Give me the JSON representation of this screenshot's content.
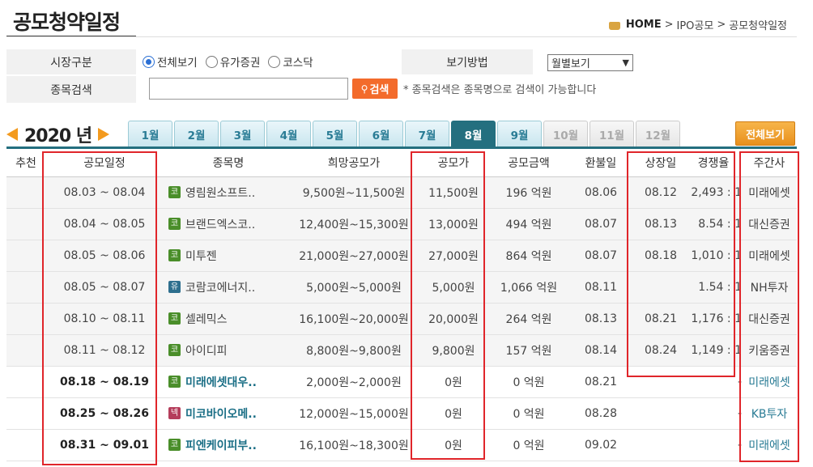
{
  "page": {
    "title": "공모청약일정",
    "breadcrumb": {
      "home": "HOME",
      "sep": ">",
      "level1": "IPO공모",
      "level2": "공모청약일정"
    }
  },
  "filters": {
    "market_label": "시장구분",
    "markets": [
      {
        "label": "전체보기",
        "checked": true
      },
      {
        "label": "유가증권",
        "checked": false
      },
      {
        "label": "코스닥",
        "checked": false
      }
    ],
    "search_label": "종목검색",
    "search_value": "",
    "search_button": "검색",
    "search_note": "* 종목검색은 종목명으로 검색이 가능합니다",
    "view_label": "보기방법",
    "view_selected": "월별보기"
  },
  "calendar": {
    "year": "2020",
    "year_suffix": "년",
    "months": [
      {
        "label": "1월",
        "state": "normal"
      },
      {
        "label": "2월",
        "state": "normal"
      },
      {
        "label": "3월",
        "state": "normal"
      },
      {
        "label": "4월",
        "state": "normal"
      },
      {
        "label": "5월",
        "state": "normal"
      },
      {
        "label": "6월",
        "state": "normal"
      },
      {
        "label": "7월",
        "state": "normal"
      },
      {
        "label": "8월",
        "state": "active"
      },
      {
        "label": "9월",
        "state": "normal"
      },
      {
        "label": "10월",
        "state": "disabled"
      },
      {
        "label": "11월",
        "state": "disabled"
      },
      {
        "label": "12월",
        "state": "disabled"
      }
    ],
    "view_all": "전체보기"
  },
  "table": {
    "headers": [
      "추천",
      "공모일정",
      "종목명",
      "희망공모가",
      "공모가",
      "공모금액",
      "환불일",
      "상장일",
      "경쟁율",
      "주간사"
    ],
    "rows": [
      {
        "recommend": "",
        "schedule": "08.03 ~ 08.04",
        "market": "코",
        "name": "영림원소프트..",
        "hope_price": "9,500원~11,500원",
        "offer_price": "11,500원",
        "amount": "196 억원",
        "refund": "08.06",
        "listing": "08.12",
        "ratio": "2,493 : 1",
        "underwriter": "미래에셋",
        "upcoming": false
      },
      {
        "recommend": "",
        "schedule": "08.04 ~ 08.05",
        "market": "코",
        "name": "브랜드엑스코..",
        "hope_price": "12,400원~15,300원",
        "offer_price": "13,000원",
        "amount": "494 억원",
        "refund": "08.07",
        "listing": "08.13",
        "ratio": "8.54 : 1",
        "underwriter": "대신증권",
        "upcoming": false
      },
      {
        "recommend": "",
        "schedule": "08.05 ~ 08.06",
        "market": "코",
        "name": "미투젠",
        "hope_price": "21,000원~27,000원",
        "offer_price": "27,000원",
        "amount": "864 억원",
        "refund": "08.07",
        "listing": "08.18",
        "ratio": "1,010 : 1",
        "underwriter": "미래에셋",
        "upcoming": false
      },
      {
        "recommend": "",
        "schedule": "08.05 ~ 08.07",
        "market": "유",
        "name": "코람코에너지..",
        "hope_price": "5,000원~5,000원",
        "offer_price": "5,000원",
        "amount": "1,066 억원",
        "refund": "08.11",
        "listing": "",
        "ratio": "1.54 : 1",
        "underwriter": "NH투자",
        "upcoming": false
      },
      {
        "recommend": "",
        "schedule": "08.10 ~ 08.11",
        "market": "코",
        "name": "셀레믹스",
        "hope_price": "16,100원~20,000원",
        "offer_price": "20,000원",
        "amount": "264 억원",
        "refund": "08.13",
        "listing": "08.21",
        "ratio": "1,176 : 1",
        "underwriter": "대신증권",
        "upcoming": false
      },
      {
        "recommend": "",
        "schedule": "08.11 ~ 08.12",
        "market": "코",
        "name": "아이디피",
        "hope_price": "8,800원~9,800원",
        "offer_price": "9,800원",
        "amount": "157 억원",
        "refund": "08.14",
        "listing": "08.24",
        "ratio": "1,149 : 1",
        "underwriter": "키움증권",
        "upcoming": false
      },
      {
        "recommend": "",
        "schedule": "08.18 ~ 08.19",
        "market": "코",
        "name": "미래에셋대우..",
        "hope_price": "2,000원~2,000원",
        "offer_price": "0원",
        "amount": "0 억원",
        "refund": "08.21",
        "listing": "",
        "ratio": "-",
        "underwriter": "미래에셋",
        "upcoming": true
      },
      {
        "recommend": "",
        "schedule": "08.25 ~ 08.26",
        "market": "넥",
        "name": "미코바이오메..",
        "hope_price": "12,000원~15,000원",
        "offer_price": "0원",
        "amount": "0 억원",
        "refund": "08.28",
        "listing": "",
        "ratio": "-",
        "underwriter": "KB투자",
        "upcoming": true
      },
      {
        "recommend": "",
        "schedule": "08.31 ~ 09.01",
        "market": "코",
        "name": "피엔케이피부..",
        "hope_price": "16,100원~18,300원",
        "offer_price": "0원",
        "amount": "0 억원",
        "refund": "09.02",
        "listing": "",
        "ratio": "-",
        "underwriter": "미래에셋",
        "upcoming": true
      }
    ]
  },
  "colors": {
    "accent_tab": "#246f7f",
    "highlight_box": "#e0252a",
    "search_button": "#f36b2b",
    "year_arrows": "#f39a1e"
  }
}
